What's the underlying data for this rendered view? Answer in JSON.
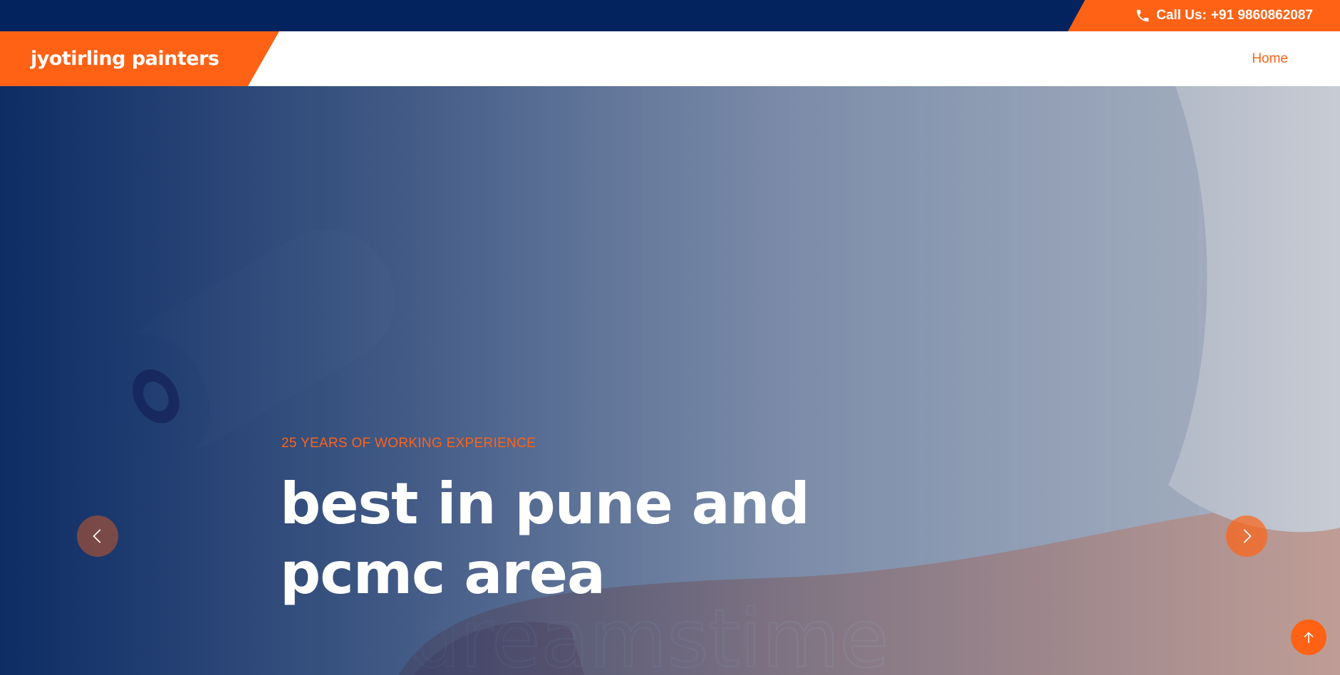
{
  "topbar": {
    "call_label": "Call Us:",
    "phone": "+91 9860862087",
    "icon": "phone-icon"
  },
  "navbar": {
    "brand": "jyotirling painters",
    "links": [
      {
        "label": "Home"
      }
    ]
  },
  "hero": {
    "subtitle": "25 YEARS OF WORKING EXPERIENCE",
    "title": "best in pune and pcmc area",
    "watermark": "dreamstime",
    "prev_icon": "chevron-left-icon",
    "next_icon": "chevron-right-icon"
  },
  "back_to_top": {
    "icon": "arrow-up-icon"
  },
  "colors": {
    "accent": "#ff6215",
    "navy": "#02235e",
    "white": "#ffffff"
  }
}
